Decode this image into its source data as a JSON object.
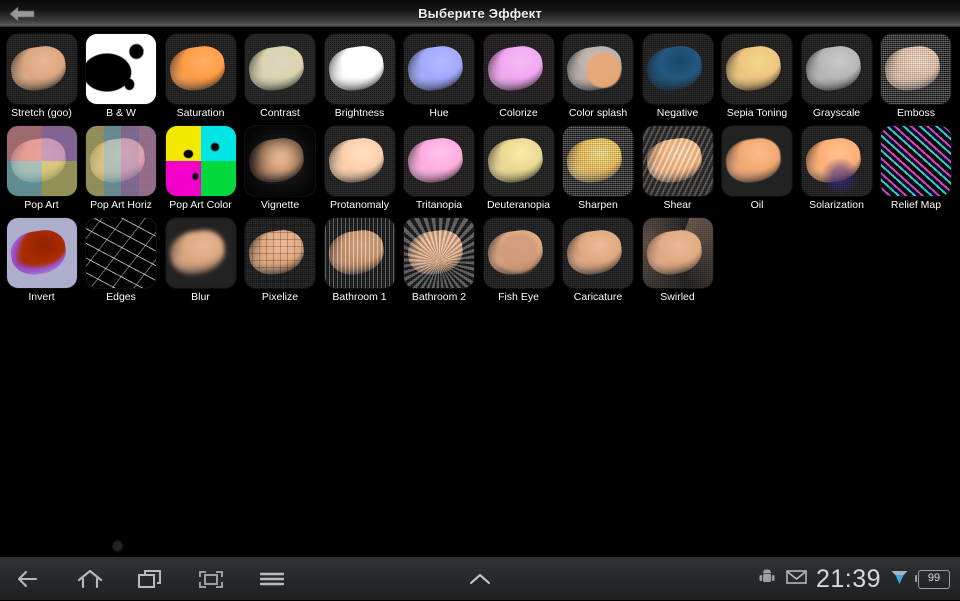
{
  "titlebar": {
    "title": "Выберите Эффект",
    "back_icon": "back-arrow-icon"
  },
  "grid": {
    "columns": 12,
    "effects": [
      {
        "label": "Stretch (goo)",
        "fx": "fx-stretch",
        "overlay": ""
      },
      {
        "label": "B & W",
        "fx": "fx-bw",
        "overlay": "bwmask"
      },
      {
        "label": "Saturation",
        "fx": "fx-saturation",
        "overlay": ""
      },
      {
        "label": "Contrast",
        "fx": "fx-contrast",
        "overlay": ""
      },
      {
        "label": "Brightness",
        "fx": "fx-brightness",
        "overlay": ""
      },
      {
        "label": "Hue",
        "fx": "fx-hue",
        "overlay": ""
      },
      {
        "label": "Colorize",
        "fx": "fx-colorize",
        "overlay": ""
      },
      {
        "label": "Color splash",
        "fx": "fx-colorsplash",
        "overlay": "splash-ov"
      },
      {
        "label": "Negative",
        "fx": "fx-negative",
        "overlay": ""
      },
      {
        "label": "Sepia Toning",
        "fx": "fx-sepia",
        "overlay": ""
      },
      {
        "label": "Grayscale",
        "fx": "fx-grayscale",
        "overlay": ""
      },
      {
        "label": "Emboss",
        "fx": "fx-emboss",
        "overlay": "sharpen-ov"
      },
      {
        "label": "Pop Art",
        "fx": "fx-stretch",
        "overlay": "popart4"
      },
      {
        "label": "Pop Art Horiz",
        "fx": "fx-stretch",
        "overlay": "popart-h"
      },
      {
        "label": "Pop Art Color",
        "fx": "fx-stretch",
        "overlay": "popart-c"
      },
      {
        "label": "Vignette",
        "fx": "fx-vignette",
        "overlay": "vignette-ov"
      },
      {
        "label": "Protanomaly",
        "fx": "fx-protanomaly",
        "overlay": ""
      },
      {
        "label": "Tritanopia",
        "fx": "fx-tritanopia",
        "overlay": ""
      },
      {
        "label": "Deuteranopia",
        "fx": "fx-deutan",
        "overlay": ""
      },
      {
        "label": "Sharpen",
        "fx": "fx-sharpen",
        "overlay": "sharpen-ov"
      },
      {
        "label": "Shear",
        "fx": "fx-shear",
        "overlay": "shear-ov"
      },
      {
        "label": "Oil",
        "fx": "fx-oil",
        "overlay": ""
      },
      {
        "label": "Solarization",
        "fx": "fx-solar",
        "overlay": "solar-ov"
      },
      {
        "label": "Relief Map",
        "fx": "fx-relief",
        "overlay": "relief-ov"
      },
      {
        "label": "Invert",
        "fx": "fx-invert",
        "overlay": ""
      },
      {
        "label": "Edges",
        "fx": "fx-edges",
        "overlay": "edges-ov"
      },
      {
        "label": "Blur",
        "fx": "fx-blur",
        "overlay": ""
      },
      {
        "label": "Pixelize",
        "fx": "fx-pixelize",
        "overlay": "pixel-ov"
      },
      {
        "label": "Bathroom 1",
        "fx": "fx-bath1",
        "overlay": "bath1-ov"
      },
      {
        "label": "Bathroom 2",
        "fx": "fx-bath2",
        "overlay": "bath2-ov"
      },
      {
        "label": "Fish Eye",
        "fx": "fx-fisheye",
        "overlay": "fisheye-ov"
      },
      {
        "label": "Caricature",
        "fx": "fx-caricature",
        "overlay": ""
      },
      {
        "label": "Swirled",
        "fx": "fx-swirled",
        "overlay": "swirl-ov"
      }
    ]
  },
  "navbar": {
    "buttons": [
      {
        "name": "nav-back",
        "icon": "back-arrow-icon"
      },
      {
        "name": "nav-home",
        "icon": "home-icon"
      },
      {
        "name": "nav-recents",
        "icon": "recent-apps-icon"
      },
      {
        "name": "nav-screenshot",
        "icon": "screenshot-icon"
      },
      {
        "name": "nav-menu",
        "icon": "hamburger-menu-icon"
      }
    ],
    "handle_icon": "chevron-up-icon",
    "status": {
      "android_icon": "android-robot-icon",
      "mail_icon": "gmail-envelope-icon",
      "clock": "21:39",
      "wifi_icon": "wifi-signal-icon",
      "battery_level": "99"
    }
  },
  "colors": {
    "background": "#000000",
    "titlebar_text": "#f2f2f2",
    "label_text": "#fafafa",
    "navbar_bg": "#26282a",
    "status_text": "#d6d9da",
    "wifi_accent": "#4aa8e0"
  }
}
